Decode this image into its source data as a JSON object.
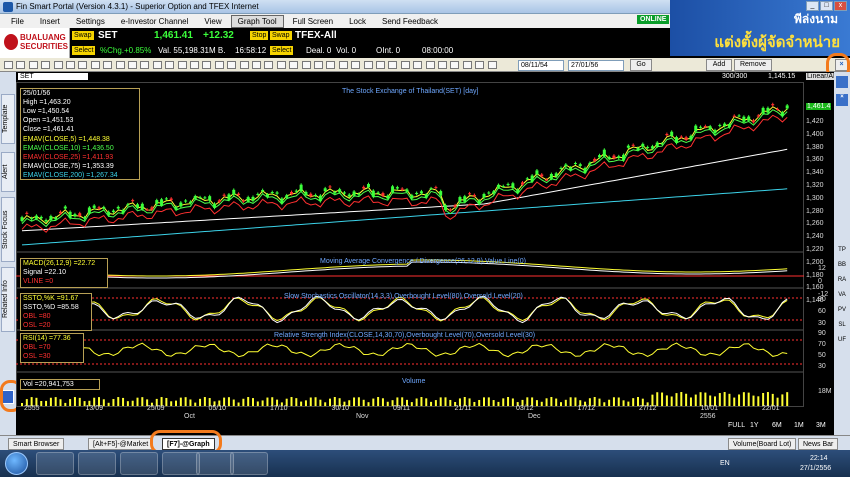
{
  "window": {
    "title": "Fin Smart Portal (Version 4.3.1) - Superior Option and TFEX Internet"
  },
  "menu": {
    "items": [
      "File",
      "Insert",
      "Settings",
      "e-Investor Channel",
      "View",
      "Graph Tool",
      "Full Screen",
      "Lock",
      "Send Feedback"
    ],
    "online": "ONLINE"
  },
  "banner": {
    "line1": "พีล่งนาม",
    "line2": "แต่งตั้งผู้จัดจำหน่าย"
  },
  "broker": {
    "name1": "BUALUANG",
    "name2": "SECURITIES"
  },
  "quote": {
    "swap1": "Swap",
    "symbol": "SET",
    "last": "1,461.41",
    "change": "+12.32",
    "select1": "Select",
    "pct": "%Chg.+0.85%",
    "val": "Val. 55,198.31M B.",
    "time": "16:58:12",
    "stop": "Stop",
    "swap2": "Swap",
    "tfex": "TFEX-All",
    "select2": "Select",
    "deal": "Deal. 0",
    "vol": "Vol. 0",
    "oint": "OInt. 0",
    "time2": "08:00:00"
  },
  "toolbar": {
    "from": "08/11/54",
    "to": "27/01/56",
    "go": "Go",
    "add": "Add",
    "remove": "Remove"
  },
  "side_tabs": [
    "Template",
    "Alert",
    "Stock Focus",
    "Related Info"
  ],
  "chart_header": {
    "symbol": "SET",
    "count": "300/300",
    "hover": "1,145.15",
    "scale": "Linear/All"
  },
  "main": {
    "title": "The Stock Exchange of Thailand(SET) [day]",
    "legend": {
      "date": "25/01/56",
      "high": "High =1,463.20",
      "low": "Low =1,450.54",
      "open": "Open =1,451.53",
      "close": "Close =1,461.41",
      "ema5": "EMAV(CLOSE,5) =1,448.38",
      "ema10": "EMAV(CLOSE,10) =1,436.50",
      "ema25": "EMAV(CLOSE,25) =1,411.93",
      "ema75": "EMAV(CLOSE,75) =1,353.39",
      "ema200": "EMAV(CLOSE,200) =1,267.34"
    },
    "yticks": [
      "1,420",
      "1,400",
      "1,380",
      "1,360",
      "1,340",
      "1,320",
      "1,300",
      "1,280",
      "1,260",
      "1,240",
      "1,220",
      "1,200",
      "1,180",
      "1,160",
      "1,140"
    ],
    "last_label": "1,461.4"
  },
  "macd": {
    "title": "Moving Average Convergence / Divergence(26,12,9),Value Line(0)",
    "l1": "MACD(26,12,9) =22.72",
    "l2": "Signal =22.10",
    "l3": "VLINE =0",
    "yticks": [
      "12",
      "0",
      "-12"
    ]
  },
  "sto": {
    "title": "Slow Stochastics Oscillator(14,3,3),Overbought Level(80),Oversold Level(20)",
    "l1": "SSTO,%K =91.67",
    "l2": "SSTO,%D =85.58",
    "l3": "OBL =80",
    "l4": "OSL =20",
    "yticks": [
      "90",
      "60",
      "30"
    ]
  },
  "rsi": {
    "title": "Relative Strength Index(CLOSE,14,30,70),Overbought Level(70),Oversold Level(30)",
    "l1": "RSI(14) =77.36",
    "l2": "OBL =70",
    "l3": "OSL =30",
    "yticks": [
      "90",
      "70",
      "50",
      "30"
    ]
  },
  "volume": {
    "title": "Volume",
    "l1": "Vol =20,941,753",
    "ytick": "18M"
  },
  "time_axis": {
    "dates": [
      "2555",
      "13/09",
      "25/09",
      "05/10",
      "17/10",
      "30/10",
      "09/11",
      "21/11",
      "03/12",
      "17/12",
      "27/12",
      "10/01",
      "22/01"
    ],
    "months": [
      "Oct",
      "Nov",
      "Dec",
      "2556"
    ],
    "zoom": [
      "FULL",
      "1Y",
      "6M",
      "1M",
      "3M"
    ]
  },
  "right_side": [
    "TP",
    "BB",
    "RA",
    "VA",
    "PV",
    "SL",
    "UF"
  ],
  "tabs": {
    "browser": "Smart Browser",
    "market": "[Alt+F5]-@Market",
    "graph": "[F7]-@Graph",
    "volume": "Volume(Board Lot)",
    "news": "News Bar"
  },
  "taskbar": {
    "lang": "EN",
    "time": "22:14",
    "date": "27/1/2556"
  }
}
